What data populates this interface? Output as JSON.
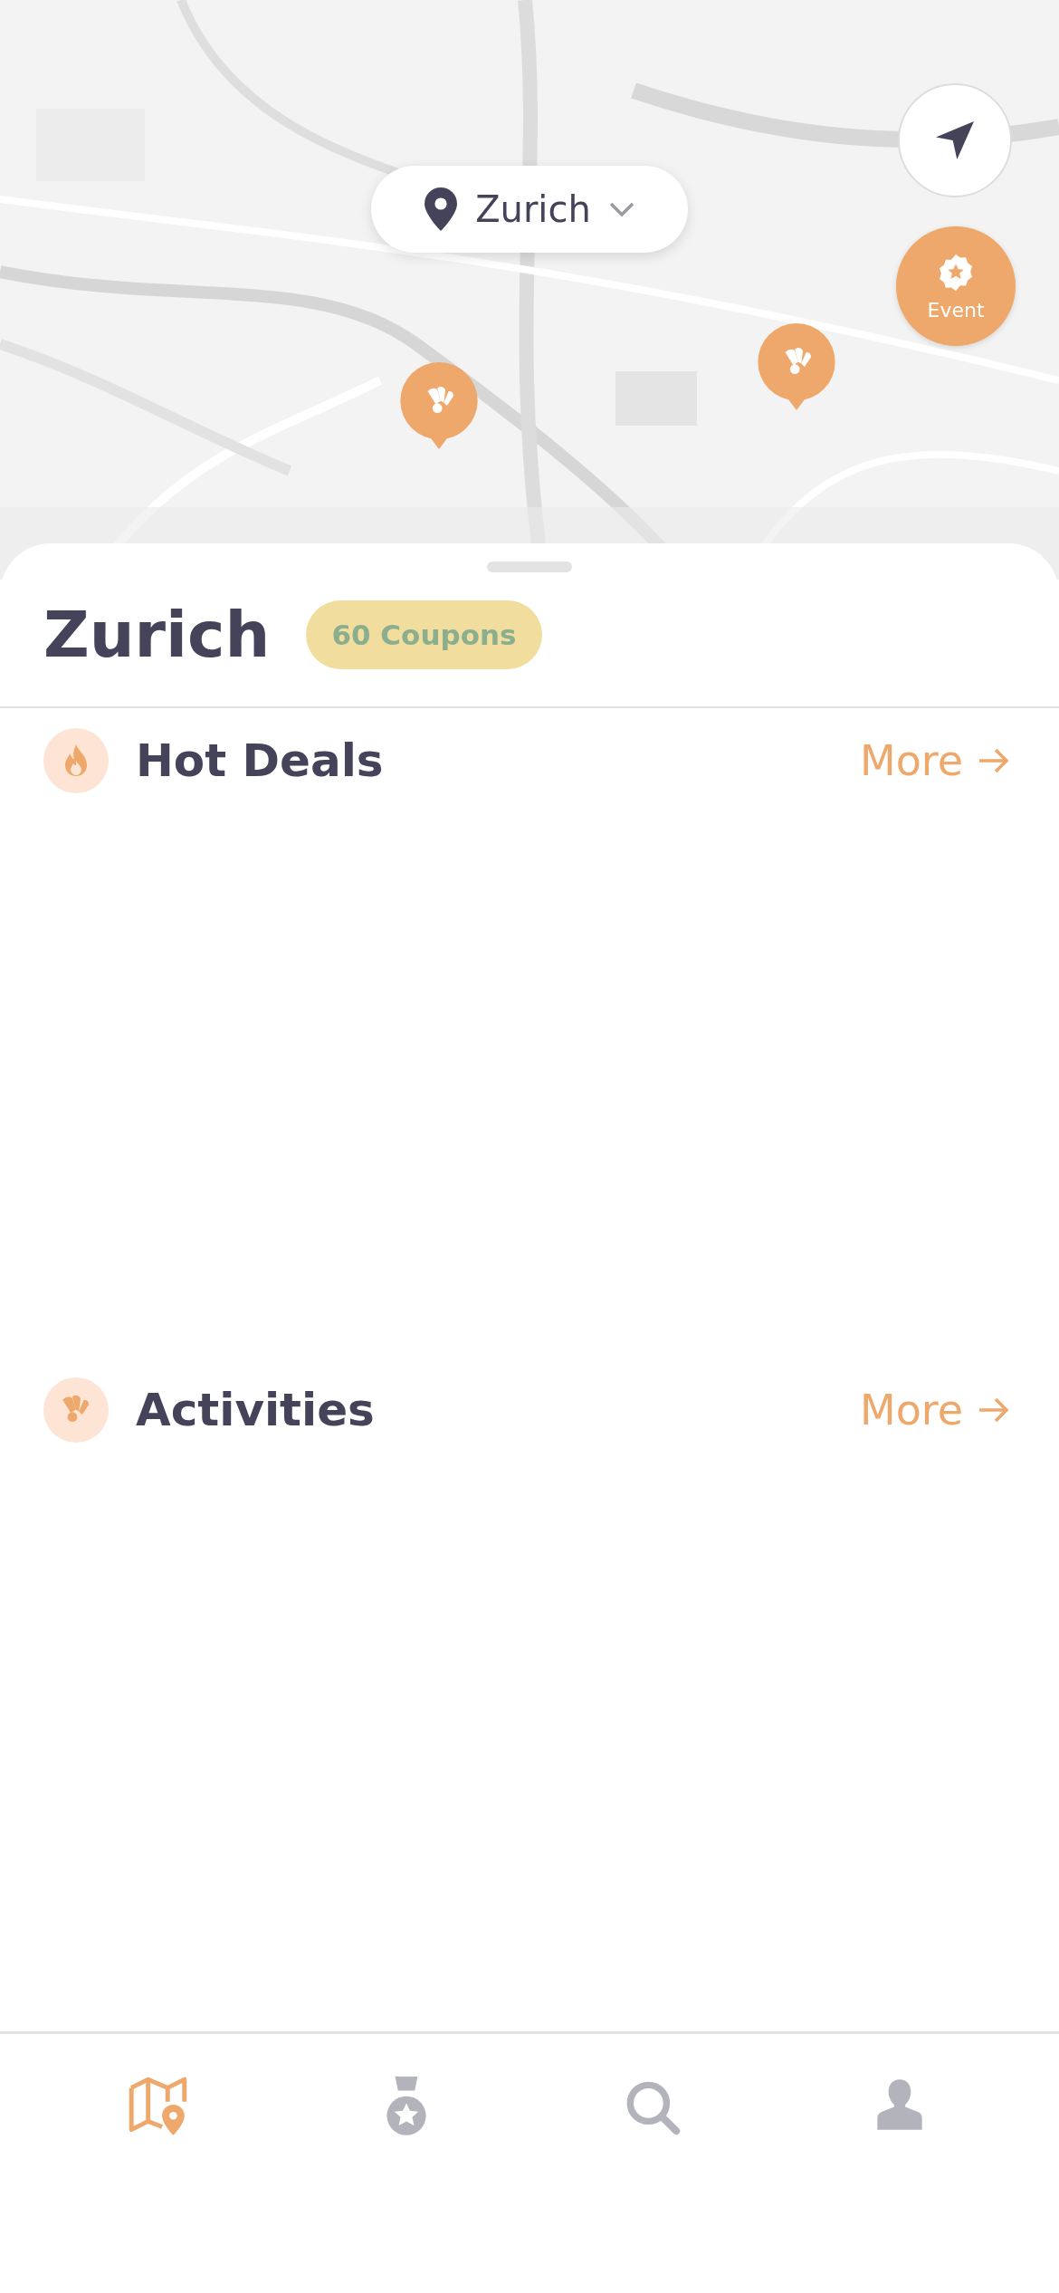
{
  "location_picker": {
    "label": "Zurich"
  },
  "markers": [
    {
      "kind": "event",
      "label": "Event"
    },
    {
      "kind": "activity"
    },
    {
      "kind": "activity"
    }
  ],
  "sheet": {
    "title": "Zurich",
    "badge": "60 Coupons"
  },
  "sections": [
    {
      "kind": "hot",
      "title": "Hot Deals",
      "action": "More"
    },
    {
      "kind": "activities",
      "title": "Activities",
      "action": "More"
    }
  ],
  "tab_bar": [
    {
      "kind": "map",
      "selected": true
    },
    {
      "kind": "rewards",
      "selected": false
    },
    {
      "kind": "search",
      "selected": false
    },
    {
      "kind": "profile",
      "selected": false
    }
  ]
}
